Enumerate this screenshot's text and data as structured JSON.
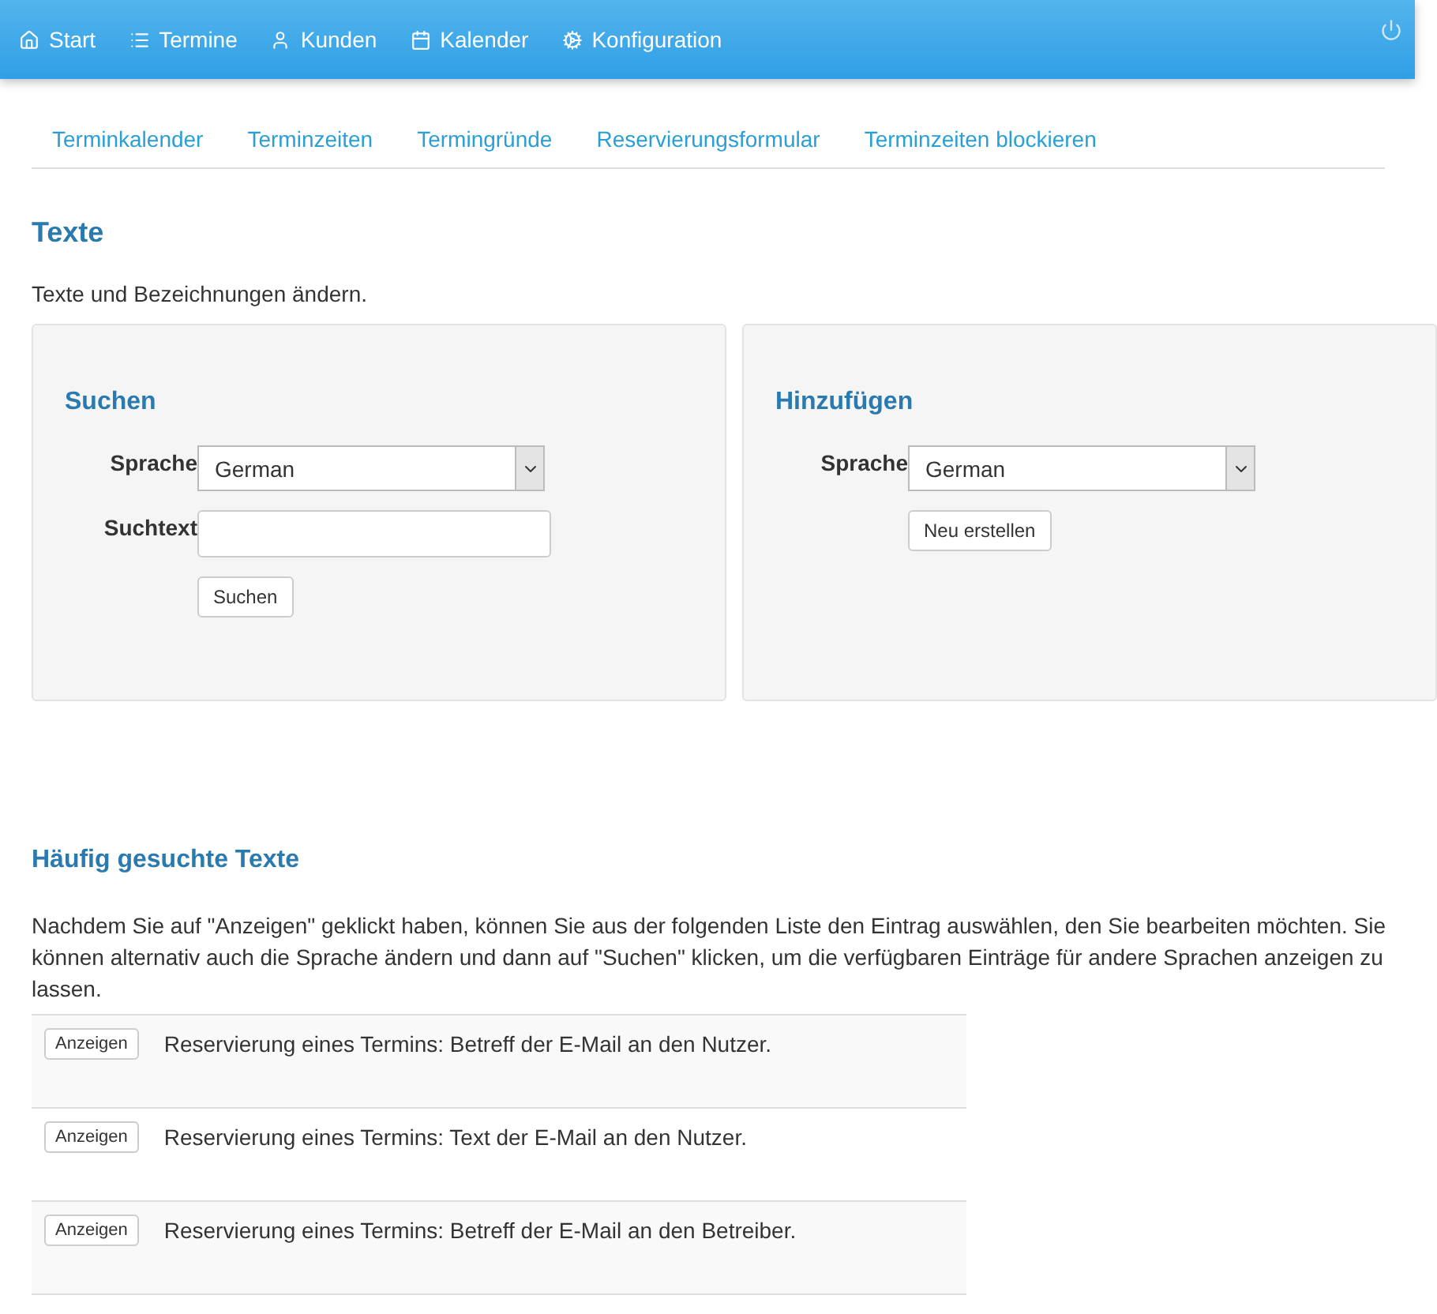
{
  "navbar": {
    "items": [
      {
        "label": "Start",
        "kind": "home"
      },
      {
        "label": "Termine",
        "kind": "list"
      },
      {
        "label": "Kunden",
        "kind": "user"
      },
      {
        "label": "Kalender",
        "kind": "calendar"
      },
      {
        "label": "Konfiguration",
        "kind": "gears"
      }
    ]
  },
  "subnav": [
    "Terminkalender",
    "Terminzeiten",
    "Termingründe",
    "Reservierungsformular",
    "Terminzeiten blockieren"
  ],
  "title": "Texte",
  "intro": "Texte und Bezeichnungen ändern.",
  "search_panel": {
    "title": "Suchen",
    "language_label": "Sprache",
    "language": "German",
    "search_label": "Suchtext",
    "button": "Suchen"
  },
  "add_panel": {
    "title": "Hinzufügen",
    "language_label": "Sprache",
    "language": "German",
    "button": "Neu erstellen"
  },
  "frequent": {
    "title": "Häufig gesuchte Texte",
    "description": "Nachdem Sie auf \"Anzeigen\" geklickt haben, können Sie aus der folgenden Liste den Eintrag auswählen, den Sie bearbeiten möchten. Sie können alternativ auch die Sprache ändern und dann auf \"Suchen\" klicken, um die verfügbaren Einträge für andere Sprachen anzeigen zu lassen.",
    "rows": [
      {
        "button": "Anzeigen",
        "text": "Reservierung eines Termins: Betreff der E-Mail an den Nutzer."
      },
      {
        "button": "Anzeigen",
        "text": "Reservierung eines Termins: Text der E-Mail an den Nutzer."
      },
      {
        "button": "Anzeigen",
        "text": "Reservierung eines Termins: Betreff der E-Mail an den Betreiber."
      }
    ]
  }
}
